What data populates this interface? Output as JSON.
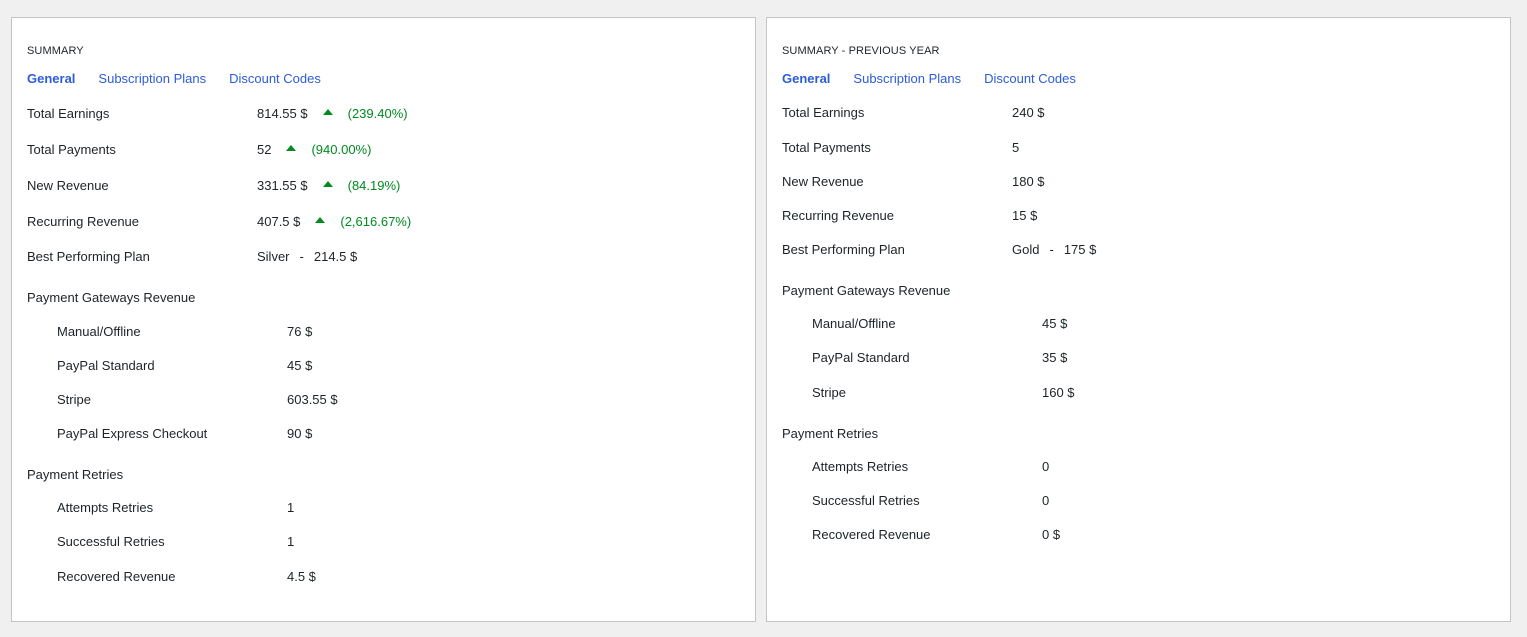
{
  "left": {
    "title": "SUMMARY",
    "tabs": [
      {
        "label": "General"
      },
      {
        "label": "Subscription Plans"
      },
      {
        "label": "Discount Codes"
      }
    ],
    "rows": [
      {
        "label": "Total Earnings",
        "value": "814.55 $",
        "change": "(239.40%)",
        "trend": "up"
      },
      {
        "label": "Total Payments",
        "value": "52",
        "change": "(940.00%)",
        "trend": "up"
      },
      {
        "label": "New Revenue",
        "value": "331.55 $",
        "change": "(84.19%)",
        "trend": "up"
      },
      {
        "label": "Recurring Revenue",
        "value": "407.5 $",
        "change": "(2,616.67%)",
        "trend": "up"
      },
      {
        "label": "Best Performing Plan",
        "plan": "Silver",
        "sep": "-",
        "amount": "214.5 $"
      }
    ],
    "gateways": {
      "heading": "Payment Gateways Revenue",
      "items": [
        {
          "label": "Manual/Offline",
          "value": "76 $"
        },
        {
          "label": "PayPal Standard",
          "value": "45 $"
        },
        {
          "label": "Stripe",
          "value": "603.55 $"
        },
        {
          "label": "PayPal Express Checkout",
          "value": "90 $"
        }
      ]
    },
    "retries": {
      "heading": "Payment Retries",
      "items": [
        {
          "label": "Attempts Retries",
          "value": "1"
        },
        {
          "label": "Successful Retries",
          "value": "1"
        },
        {
          "label": "Recovered Revenue",
          "value": "4.5 $"
        }
      ]
    }
  },
  "right": {
    "title": "SUMMARY - PREVIOUS YEAR",
    "tabs": [
      {
        "label": "General"
      },
      {
        "label": "Subscription Plans"
      },
      {
        "label": "Discount Codes"
      }
    ],
    "rows": [
      {
        "label": "Total Earnings",
        "value": "240 $"
      },
      {
        "label": "Total Payments",
        "value": "5"
      },
      {
        "label": "New Revenue",
        "value": "180 $"
      },
      {
        "label": "Recurring Revenue",
        "value": "15 $"
      },
      {
        "label": "Best Performing Plan",
        "plan": "Gold",
        "sep": "-",
        "amount": "175 $"
      }
    ],
    "gateways": {
      "heading": "Payment Gateways Revenue",
      "items": [
        {
          "label": "Manual/Offline",
          "value": "45 $"
        },
        {
          "label": "PayPal Standard",
          "value": "35 $"
        },
        {
          "label": "Stripe",
          "value": "160 $"
        }
      ]
    },
    "retries": {
      "heading": "Payment Retries",
      "items": [
        {
          "label": "Attempts Retries",
          "value": "0"
        },
        {
          "label": "Successful Retries",
          "value": "0"
        },
        {
          "label": "Recovered Revenue",
          "value": "0 $"
        }
      ]
    }
  },
  "colors": {
    "accent": "#2c5dd6",
    "positive": "#008a20",
    "background": "#f0f0f1",
    "panel": "#ffffff"
  }
}
